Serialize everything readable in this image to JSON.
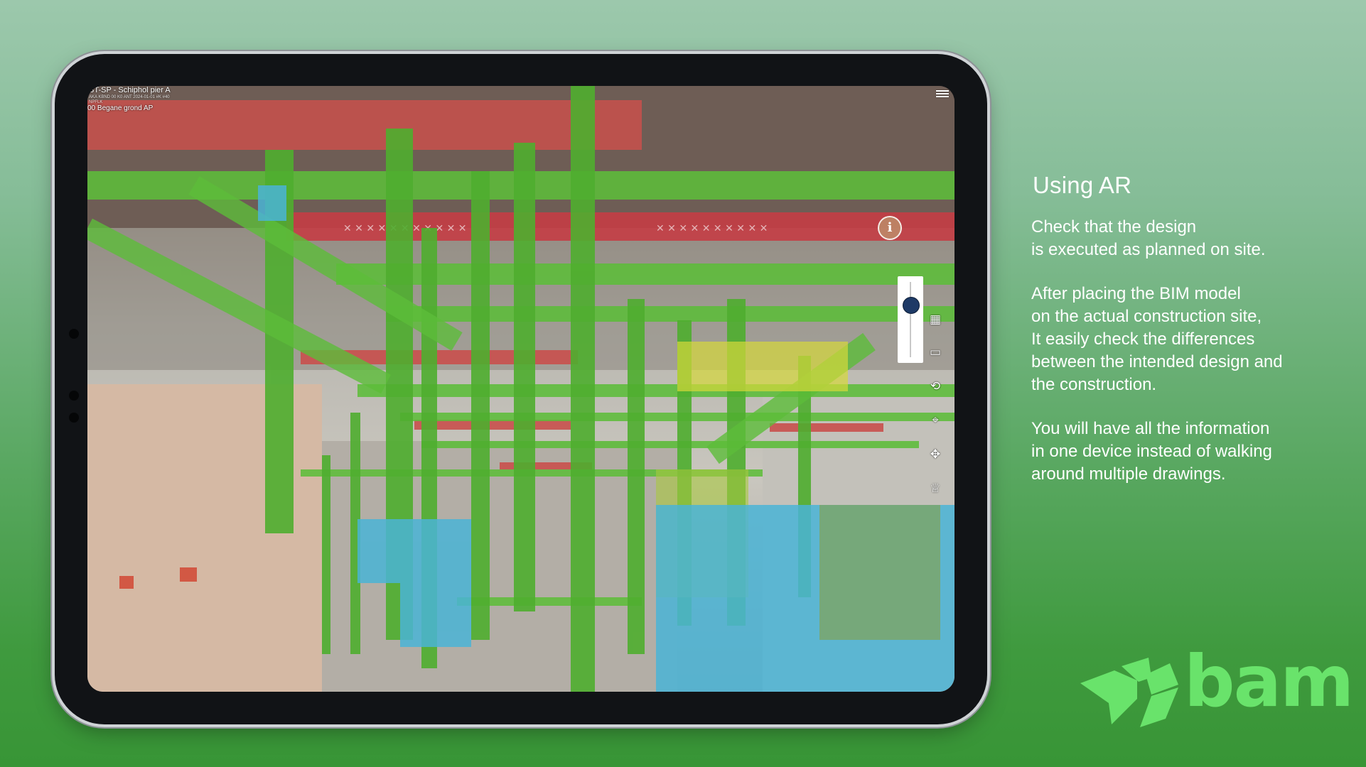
{
  "ar_app": {
    "project_title": "ST-SP - Schiphol pier A",
    "location_meta": [
      "AKA KBND 00 K0 ANT 2024-01-01 #K #40",
      "NPFLK"
    ],
    "floor_label": "00 Begane grond AP",
    "toolbar": {
      "menu_icon": "menu-icon",
      "slider_value": 0.25,
      "tools": [
        "grid-icon",
        "section-icon",
        "rotate-icon",
        "crosshair-icon",
        "move-icon",
        "light-icon"
      ],
      "info_icon": "info-icon",
      "info_label": "i"
    }
  },
  "panel": {
    "heading": "Using AR",
    "paragraphs": [
      "Check that the design\nis executed  as planned on site.",
      "After placing the BIM model\non the actual construction site,\nIt easily check the differences\nbetween the intended design and\nthe construction.",
      "You will have all the information\nin one device instead of walking\naround multiple drawings."
    ]
  },
  "logo": {
    "wordmark": "bam",
    "color": "#69e36b"
  },
  "colors": {
    "pipe_green": "#5dbd3a",
    "pipe_red": "#c9504c",
    "duct_blue": "#4ab4d6",
    "accent_yellow": "#d6d83a"
  }
}
